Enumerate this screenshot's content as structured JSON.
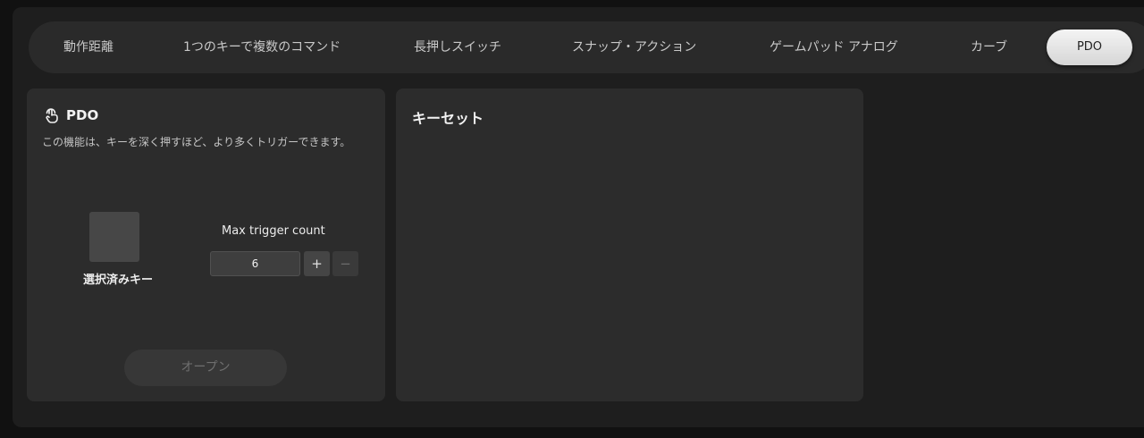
{
  "tabs": [
    {
      "label": "動作距離",
      "active": false
    },
    {
      "label": "1つのキーで複数のコマンド",
      "active": false
    },
    {
      "label": "長押しスイッチ",
      "active": false
    },
    {
      "label": "スナップ・アクション",
      "active": false
    },
    {
      "label": "ゲームパッド アナログ",
      "active": false
    },
    {
      "label": "カーブ",
      "active": false
    },
    {
      "label": "PDO",
      "active": true
    }
  ],
  "pdo_panel": {
    "icon": "tap-finger-icon",
    "title": "PDO",
    "description": "この機能は、キーを深く押すほど、より多くトリガーできます。",
    "selected_key_label": "選択済みキー",
    "max_trigger_label": "Max trigger count",
    "max_trigger_value": "6",
    "plus_label": "+",
    "minus_label": "−",
    "open_button_label": "オープン"
  },
  "keyset_panel": {
    "title": "キーセット"
  },
  "colors": {
    "background": "#111111",
    "frame": "#1e1e1e",
    "panel": "#2c2c2c",
    "active_tab": "#e8e8e8"
  }
}
